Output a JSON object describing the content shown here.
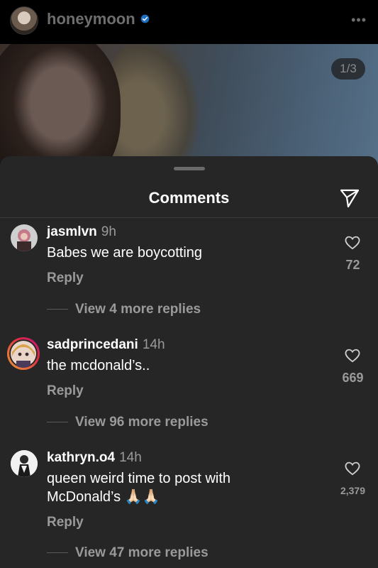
{
  "post": {
    "username": "honeymoon",
    "image_counter": "1/3"
  },
  "sheet": {
    "title": "Comments"
  },
  "comments": [
    {
      "username": "jasmlvn",
      "time": "9h",
      "text": "Babes we are boycotting",
      "reply_label": "Reply",
      "view_replies": "View 4 more replies",
      "likes": "72"
    },
    {
      "username": "sadprincedani",
      "time": "14h",
      "text": "the mcdonald’s..",
      "reply_label": "Reply",
      "view_replies": "View 96 more replies",
      "likes": "669"
    },
    {
      "username": "kathryn.o4",
      "time": "14h",
      "text": "queen weird time to post with McDonald’s 🙏🏻🙏🏻",
      "reply_label": "Reply",
      "view_replies": "View 47 more replies",
      "likes": "2,379"
    }
  ],
  "colors": {
    "sheet_bg": "#262626",
    "muted_text": "#9a9a9a",
    "verified_blue": "#3897f0"
  }
}
